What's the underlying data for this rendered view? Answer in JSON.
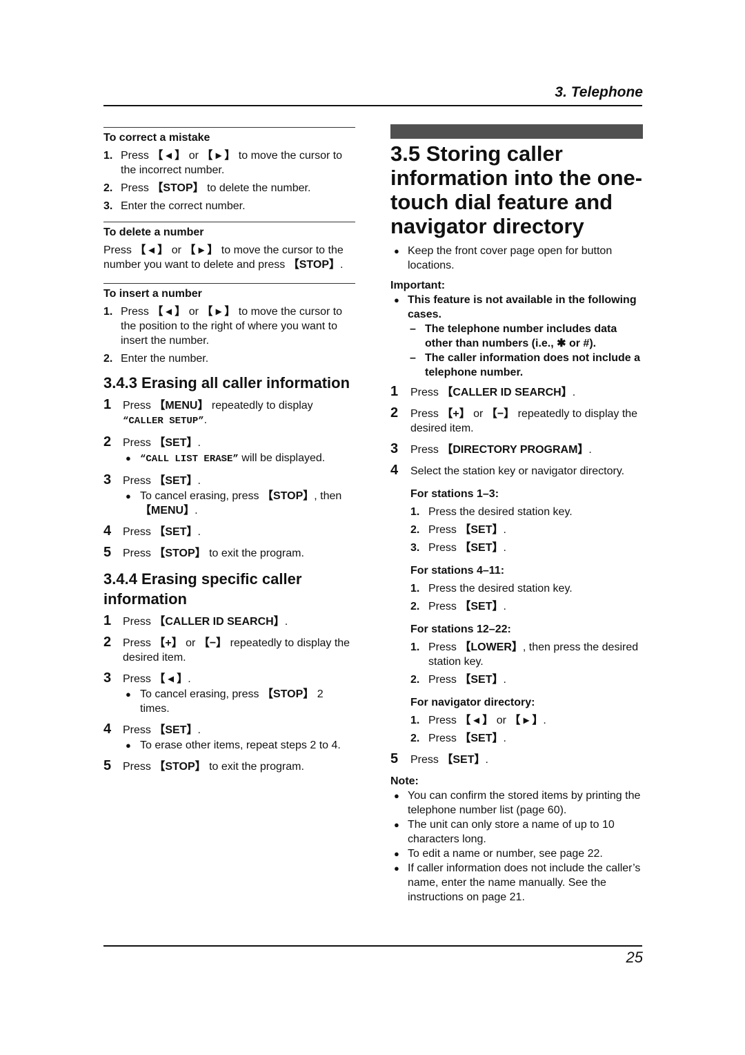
{
  "header": {
    "section": "3. Telephone"
  },
  "footer": {
    "page_number": "25"
  },
  "left": {
    "correct": {
      "title": "To correct a mistake",
      "items": [
        {
          "n": "1.",
          "a": "Press ",
          "k1": "【 ◂ 】",
          "b": " or ",
          "k2": "【 ▸ 】",
          "c": " to move the cursor to the incorrect number."
        },
        {
          "n": "2.",
          "a": "Press ",
          "k1": "【STOP】",
          "c": " to delete the number."
        },
        {
          "n": "3.",
          "a": "Enter the correct number."
        }
      ]
    },
    "delete": {
      "title": "To delete a number",
      "a": "Press ",
      "k1": "【 ◂ 】",
      "b": " or ",
      "k2": "【 ▸ 】",
      "c": " to move the cursor to the number you want to delete and press ",
      "k3": "【STOP】",
      "d": "."
    },
    "insert": {
      "title": "To insert a number",
      "items": [
        {
          "n": "1.",
          "a": "Press ",
          "k1": "【 ◂ 】",
          "b": " or ",
          "k2": "【 ▸ 】",
          "c": " to move the cursor to the position to the right of where you want to insert the number."
        },
        {
          "n": "2.",
          "a": "Enter the number."
        }
      ]
    },
    "sec343": {
      "title": "3.4.3 Erasing all caller information",
      "steps": [
        {
          "n": "1",
          "a": "Press ",
          "k": "【MENU】",
          "b": " repeatedly to display ",
          "m": "“CALLER SETUP”",
          "c": "."
        },
        {
          "n": "2",
          "a": "Press ",
          "k": "【SET】",
          "c": ".",
          "bullet_m": "“CALL LIST ERASE”",
          "bullet": " will be displayed."
        },
        {
          "n": "3",
          "a": "Press ",
          "k": "【SET】",
          "c": ".",
          "bullet": "To cancel erasing, press ",
          "bullet_k": "【STOP】",
          "bullet_b": ", then ",
          "bullet_k2": "【MENU】",
          "bullet_c": "."
        },
        {
          "n": "4",
          "a": "Press ",
          "k": "【SET】",
          "c": "."
        },
        {
          "n": "5",
          "a": "Press ",
          "k": "【STOP】",
          "c": " to exit the program."
        }
      ]
    },
    "sec344": {
      "title": "3.4.4 Erasing specific caller information",
      "steps": [
        {
          "n": "1",
          "a": "Press ",
          "k": "【CALLER ID SEARCH】",
          "c": "."
        },
        {
          "n": "2",
          "a": "Press ",
          "k": "【+】",
          "b": " or ",
          "k2": "【−】",
          "c": " repeatedly to display the desired item."
        },
        {
          "n": "3",
          "a": "Press ",
          "k": "【 ◂ 】",
          "c": ".",
          "bullet": "To cancel erasing, press ",
          "bullet_k": "【STOP】",
          "bullet_c": " 2 times."
        },
        {
          "n": "4",
          "a": "Press ",
          "k": "【SET】",
          "c": ".",
          "bullet": "To erase other items, repeat steps 2 to 4."
        },
        {
          "n": "5",
          "a": "Press ",
          "k": "【STOP】",
          "c": " to exit the program."
        }
      ]
    }
  },
  "right": {
    "title": "3.5 Storing caller information into the one-touch dial feature and navigator directory",
    "intro_bullet": "Keep the front cover page open for button locations.",
    "important_label": "Important:",
    "important_bullet": "This feature is not available in the following cases.",
    "dashes": [
      "The telephone number includes data other than numbers (i.e., ✱ or #).",
      "The caller information does not include a telephone number."
    ],
    "steps": [
      {
        "n": "1",
        "a": "Press ",
        "k": "【CALLER ID SEARCH】",
        "c": "."
      },
      {
        "n": "2",
        "a": "Press ",
        "k": "【+】",
        "b": " or ",
        "k2": "【−】",
        "c": " repeatedly to display the desired item."
      },
      {
        "n": "3",
        "a": "Press ",
        "k": "【DIRECTORY PROGRAM】",
        "c": "."
      },
      {
        "n": "4",
        "a": "Select the station key or navigator directory."
      }
    ],
    "groups": [
      {
        "label": "For stations 1–3:",
        "items": [
          {
            "n": "1.",
            "a": "Press the desired station key."
          },
          {
            "n": "2.",
            "a": "Press ",
            "k": "【SET】",
            "c": "."
          },
          {
            "n": "3.",
            "a": "Press ",
            "k": "【SET】",
            "c": "."
          }
        ]
      },
      {
        "label": "For stations 4–11:",
        "items": [
          {
            "n": "1.",
            "a": "Press the desired station key."
          },
          {
            "n": "2.",
            "a": "Press ",
            "k": "【SET】",
            "c": "."
          }
        ]
      },
      {
        "label": "For stations 12–22:",
        "items": [
          {
            "n": "1.",
            "a": "Press ",
            "k": "【LOWER】",
            "c": ", then press the desired station key."
          },
          {
            "n": "2.",
            "a": "Press ",
            "k": "【SET】",
            "c": "."
          }
        ]
      },
      {
        "label": "For navigator directory:",
        "items": [
          {
            "n": "1.",
            "a": "Press ",
            "k": "【 ◂ 】",
            "b": " or ",
            "k2": "【 ▸ 】",
            "c": "."
          },
          {
            "n": "2.",
            "a": "Press ",
            "k": "【SET】",
            "c": "."
          }
        ]
      }
    ],
    "step5": {
      "n": "5",
      "a": "Press ",
      "k": "【SET】",
      "c": "."
    },
    "note_label": "Note:",
    "notes": [
      "You can confirm the stored items by printing the telephone number list (page 60).",
      "The unit can only store a name of up to 10 characters long.",
      "To edit a name or number, see page 22.",
      "If caller information does not include the caller’s name, enter the name manually. See the instructions on page 21."
    ]
  }
}
